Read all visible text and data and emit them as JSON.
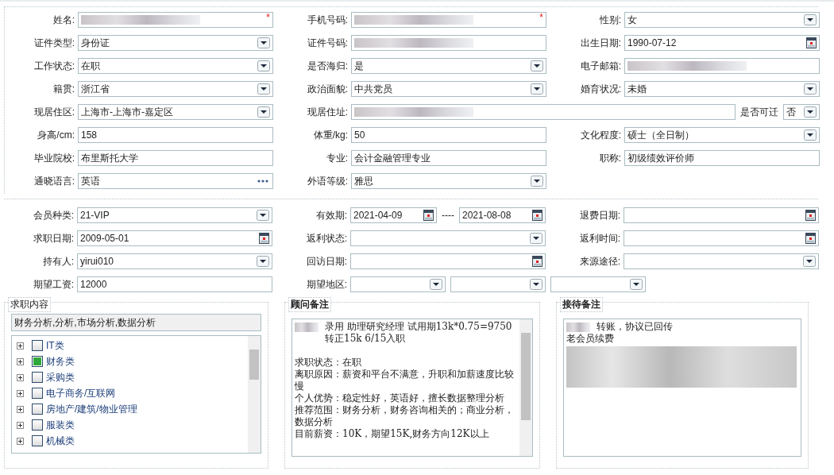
{
  "sections": [
    {
      "rows": [
        [
          {
            "label": "姓名:",
            "controls": [
              {
                "kind": "text",
                "redacted": true,
                "required": "*"
              }
            ]
          },
          {
            "label": "手机号码:",
            "controls": [
              {
                "kind": "text",
                "redacted": true,
                "required": "*"
              }
            ]
          },
          {
            "label": "性别:",
            "controls": [
              {
                "kind": "select",
                "value": "女"
              }
            ]
          }
        ],
        [
          {
            "label": "证件类型:",
            "controls": [
              {
                "kind": "select",
                "value": "身份证"
              }
            ]
          },
          {
            "label": "证件号码:",
            "controls": [
              {
                "kind": "text",
                "redacted": true
              }
            ]
          },
          {
            "label": "出生日期:",
            "controls": [
              {
                "kind": "date",
                "value": "1990-07-12"
              }
            ]
          }
        ],
        [
          {
            "label": "工作状态:",
            "controls": [
              {
                "kind": "select",
                "value": "在职"
              }
            ]
          },
          {
            "label": "是否海归:",
            "controls": [
              {
                "kind": "select",
                "value": "是"
              }
            ]
          },
          {
            "label": "电子邮箱:",
            "controls": [
              {
                "kind": "text",
                "redacted": true
              }
            ]
          }
        ],
        [
          {
            "label": "籍贯:",
            "controls": [
              {
                "kind": "select",
                "value": "浙江省"
              }
            ]
          },
          {
            "label": "政治面貌:",
            "controls": [
              {
                "kind": "select",
                "value": "中共党员"
              }
            ]
          },
          {
            "label": "婚育状况:",
            "controls": [
              {
                "kind": "select",
                "value": "未婚"
              }
            ]
          }
        ],
        [
          {
            "label": "现居住区:",
            "controls": [
              {
                "kind": "select",
                "value": " 上海市-上海市-嘉定区"
              }
            ]
          },
          {
            "label": "现居住址:",
            "wide": true,
            "controls": [
              {
                "kind": "text",
                "redacted": true,
                "grow": true
              },
              {
                "kind": "caption",
                "value": "是否可迁"
              },
              {
                "kind": "select",
                "value": "否",
                "small": true
              }
            ]
          }
        ],
        [
          {
            "label": "身高/cm:",
            "controls": [
              {
                "kind": "text",
                "value": "158"
              }
            ]
          },
          {
            "label": "体重/kg:",
            "controls": [
              {
                "kind": "text",
                "value": "50"
              }
            ]
          },
          {
            "label": "文化程度:",
            "controls": [
              {
                "kind": "select",
                "value": "硕士（全日制）"
              }
            ]
          }
        ],
        [
          {
            "label": "毕业院校:",
            "controls": [
              {
                "kind": "text",
                "value": "布里斯托大学"
              }
            ]
          },
          {
            "label": "专业:",
            "controls": [
              {
                "kind": "text",
                "value": "会计金融管理专业"
              }
            ]
          },
          {
            "label": "职称:",
            "controls": [
              {
                "kind": "text",
                "value": "初级绩效评价师"
              }
            ]
          }
        ],
        [
          {
            "label": "通晓语言:",
            "controls": [
              {
                "kind": "picker",
                "value": "英语"
              }
            ]
          },
          {
            "label": "外语等级:",
            "controls": [
              {
                "kind": "select",
                "value": "雅思"
              }
            ]
          }
        ]
      ]
    },
    {
      "rows": [
        [
          {
            "label": "会员种类:",
            "controls": [
              {
                "kind": "select",
                "value": " 21-VIP"
              }
            ]
          },
          {
            "label": "有效期:",
            "controls": [
              {
                "kind": "date",
                "value": "2021-04-09",
                "grow": true
              },
              {
                "kind": "caption",
                "value": "----"
              },
              {
                "kind": "date",
                "value": "2021-08-08",
                "grow": true
              }
            ]
          },
          {
            "label": "退费日期:",
            "controls": [
              {
                "kind": "date"
              }
            ]
          }
        ],
        [
          {
            "label": "求职日期:",
            "controls": [
              {
                "kind": "date",
                "value": "2009-05-01"
              }
            ]
          },
          {
            "label": "返利状态:",
            "controls": [
              {
                "kind": "select"
              }
            ]
          },
          {
            "label": "返利时间:",
            "controls": [
              {
                "kind": "date"
              }
            ]
          }
        ],
        [
          {
            "label": "持有人:",
            "controls": [
              {
                "kind": "select",
                "value": "yirui010"
              }
            ]
          },
          {
            "label": "回访日期:",
            "controls": [
              {
                "kind": "date"
              }
            ]
          },
          {
            "label": "来源途径:",
            "controls": [
              {
                "kind": "select"
              }
            ]
          }
        ],
        [
          {
            "label": "期望工资:",
            "controls": [
              {
                "kind": "text",
                "value": "12000"
              }
            ]
          },
          {
            "label": "期望地区:",
            "cascade": true,
            "controls": [
              {
                "kind": "select"
              },
              {
                "kind": "select"
              },
              {
                "kind": "select"
              }
            ]
          }
        ]
      ]
    }
  ],
  "job_panel": {
    "legend": "求职内容",
    "summary": "财务分析,分析,市场分析,数据分析",
    "tree": [
      {
        "label": "IT类",
        "checked": false
      },
      {
        "label": "财务类",
        "checked": true
      },
      {
        "label": "采购类",
        "checked": false
      },
      {
        "label": "电子商务/互联网",
        "checked": false
      },
      {
        "label": "房地产/建筑/物业管理",
        "checked": false
      },
      {
        "label": "服装类",
        "checked": false
      },
      {
        "label": "机械类",
        "checked": false
      }
    ]
  },
  "notes": [
    {
      "legend": "顾问备注",
      "scrollbar": true,
      "lines": [
        {
          "text": "录用  助理研究经理 试用期13k*0.75=9750  转正15k  6/15入职",
          "redacted_prefix": true
        },
        {
          "text": "求职状态：在职",
          "gap_before": true
        },
        {
          "text": "离职原因：薪资和平台不满意，升职和加薪速度比较慢"
        },
        {
          "text": "个人优势：稳定性好，英语好，擅长数据整理分析"
        },
        {
          "text": "推荐范围：财务分析，财务咨询相关的；商业分析，数据分析"
        },
        {
          "text": "目前薪资：10K，期望15K,财务方向12K以上"
        }
      ]
    },
    {
      "legend": "接待备注",
      "scrollbar": false,
      "lines": [
        {
          "text": "转账，协议已回传",
          "redacted_prefix": true
        },
        {
          "text": "老会员续费"
        },
        {
          "redacted_block": true
        }
      ]
    }
  ]
}
